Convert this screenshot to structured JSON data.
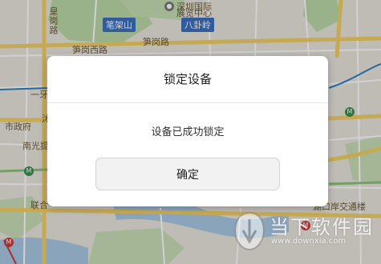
{
  "map": {
    "labels": {
      "bijiashan": "笔架山",
      "bagualing": "八卦岭",
      "huanggang": "皇岗路",
      "sungang_west": "笋岗西路",
      "sungang_road": "笋岗路",
      "shenzhen_intl": "深圳国际",
      "exhibition": "展览中心",
      "city_gov": "市政府",
      "nanguang": "南光提",
      "yishi": "一牙",
      "lianhe": "联合",
      "ferry": "湖口岸交通楼",
      "mu": "沐"
    }
  },
  "dialog": {
    "title": "锁定设备",
    "message": "设备已成功锁定",
    "confirm_label": "确定"
  },
  "watermark": {
    "brand": "当下软件园",
    "url": "www.downxia.com"
  },
  "colors": {
    "map_bg": "#e9e6df",
    "park_green": "#b9d9a8",
    "water": "#a8c8e8",
    "road_yellow": "#f6d26a",
    "dialog_bg": "#ffffff",
    "button_bg": "#f2f2f2"
  }
}
